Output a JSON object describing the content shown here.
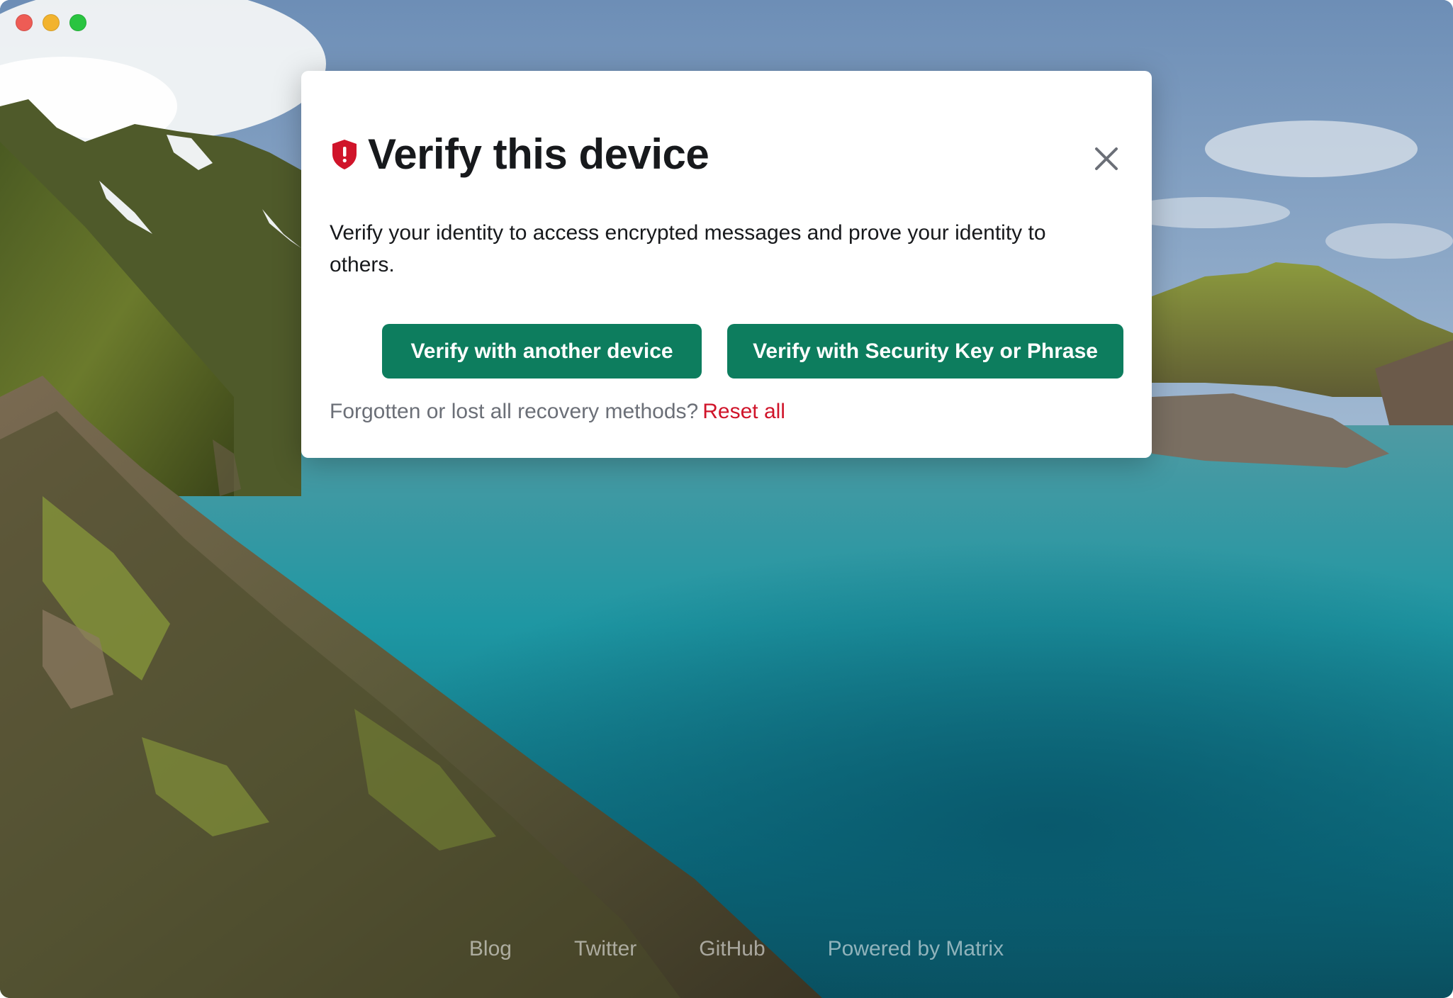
{
  "window": {
    "traffic_lights": [
      {
        "name": "close",
        "color": "#ee5c55"
      },
      {
        "name": "minimize",
        "color": "#f2b32e"
      },
      {
        "name": "zoom",
        "color": "#29c440"
      }
    ]
  },
  "dialog": {
    "icon": "shield-alert-icon",
    "icon_color": "#d0142a",
    "title": "Verify this device",
    "description": "Verify your identity to access encrypted messages and prove your identity to others.",
    "buttons": {
      "verify_device": "Verify with another device",
      "verify_key": "Verify with Security Key or Phrase"
    },
    "recovery_text": "Forgotten or lost all recovery methods?",
    "reset_link": "Reset all",
    "accent": "#0d7d5e"
  },
  "footer": {
    "links": [
      "Blog",
      "Twitter",
      "GitHub",
      "Powered by Matrix"
    ]
  }
}
